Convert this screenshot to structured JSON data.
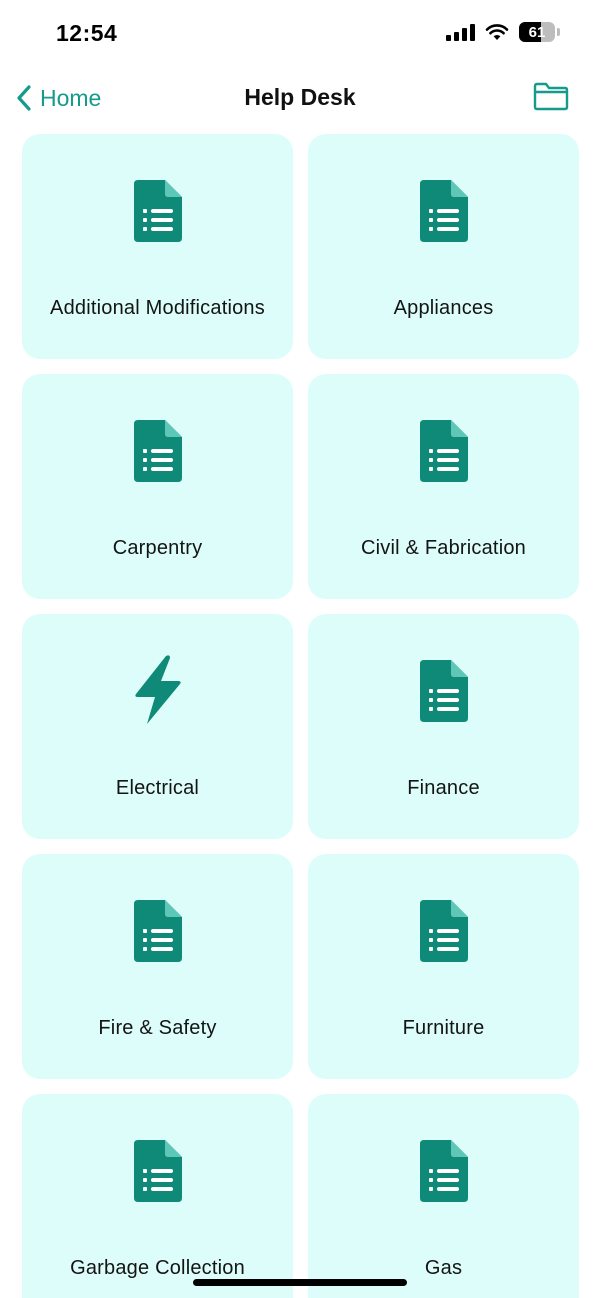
{
  "status_bar": {
    "time": "12:54",
    "battery": "61"
  },
  "nav": {
    "back_label": "Home",
    "title": "Help Desk"
  },
  "colors": {
    "accent": "#159a8c",
    "icon": "#0f8a78",
    "card_bg": "#dcfdf9"
  },
  "categories": [
    {
      "label": "Additional Modifications",
      "icon": "document-list-icon"
    },
    {
      "label": "Appliances",
      "icon": "document-list-icon"
    },
    {
      "label": "Carpentry",
      "icon": "document-list-icon"
    },
    {
      "label": "Civil & Fabrication",
      "icon": "document-list-icon"
    },
    {
      "label": "Electrical",
      "icon": "lightning-bolt-icon"
    },
    {
      "label": "Finance",
      "icon": "document-list-icon"
    },
    {
      "label": "Fire & Safety",
      "icon": "document-list-icon"
    },
    {
      "label": "Furniture",
      "icon": "document-list-icon"
    },
    {
      "label": "Garbage Collection",
      "icon": "document-list-icon"
    },
    {
      "label": "Gas",
      "icon": "document-list-icon"
    }
  ]
}
